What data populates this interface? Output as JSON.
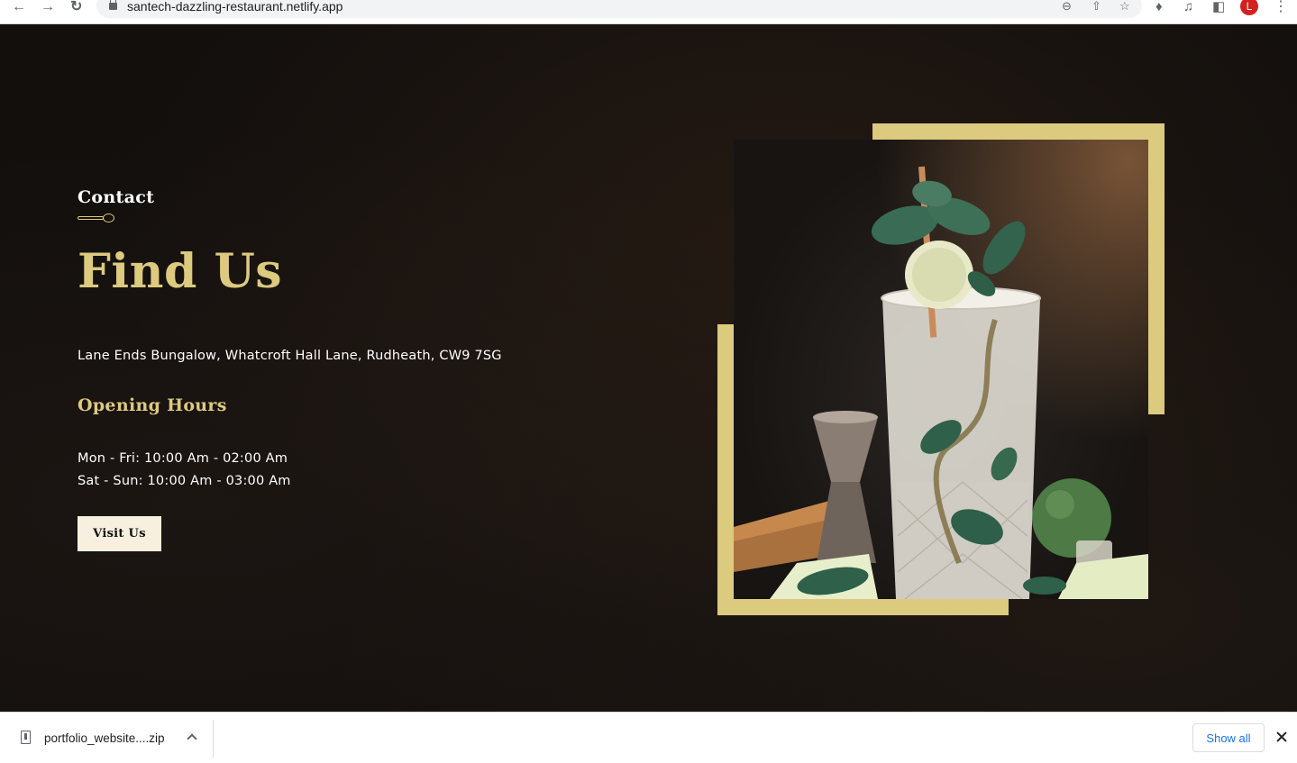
{
  "browser": {
    "url": "santech-dazzling-restaurant.netlify.app",
    "profile_initial": "L",
    "icons": [
      "back-icon",
      "forward-icon",
      "reload-icon",
      "lock-icon",
      "zoom-out-icon",
      "share-icon",
      "bookmark-star-icon",
      "extensions-icon",
      "media-control-icon",
      "side-panel-icon",
      "profile-avatar",
      "more-menu-icon"
    ]
  },
  "contact": {
    "eyebrow": "Contact",
    "heading": "Find Us",
    "address": "Lane Ends Bungalow, Whatcroft Hall Lane, Rudheath, CW9 7SG",
    "hours_title": "Opening Hours",
    "hours": [
      "Mon - Fri: 10:00 Am - 02:00 Am",
      "Sat - Sun: 10:00 Am - 03:00 Am"
    ],
    "button_label": "Visit Us"
  },
  "colors": {
    "accent_gold": "#dcca7e",
    "button_bg": "#f7f0de",
    "page_bg": "#120f0d",
    "link_blue": "#1a73e8"
  },
  "downloads": {
    "file_name": "portfolio_website....zip",
    "show_all_label": "Show all"
  }
}
